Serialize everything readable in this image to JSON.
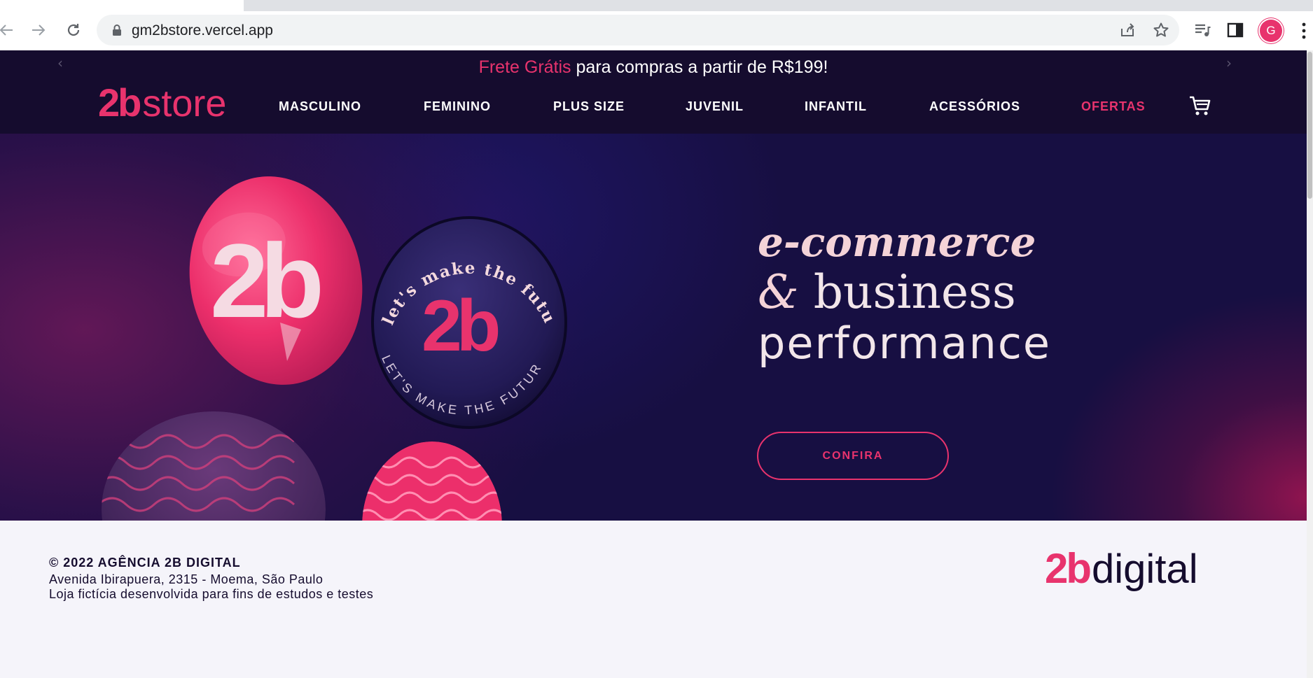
{
  "browser": {
    "url": "gm2bstore.vercel.app",
    "profile_initial": "G",
    "icons": [
      "back-icon",
      "forward-icon",
      "reload-icon",
      "lock-icon",
      "share-icon",
      "star-icon",
      "media-icon",
      "side-panel-icon",
      "menu-icon"
    ]
  },
  "header": {
    "promo_highlight": "Frete Grátis",
    "promo_rest": " para compras a partir de R$199!",
    "prev_arrow": "‹",
    "next_arrow": "›",
    "logo_bold": "2b",
    "logo_light": "store",
    "nav": [
      {
        "label": "MASCULINO"
      },
      {
        "label": "FEMININO"
      },
      {
        "label": "PLUS SIZE"
      },
      {
        "label": "JUVENIL"
      },
      {
        "label": "INFANTIL"
      },
      {
        "label": "ACESSÓRIOS"
      },
      {
        "label": "OFERTAS"
      }
    ]
  },
  "hero": {
    "line1": "e-commerce",
    "line2_amp": "&",
    "line2_rest": " business",
    "line3": "performance",
    "cta_label": "CONFIRA",
    "badge_text": "2b",
    "ring_top": "let's make the future now.",
    "ring_bottom": "LET'S MAKE THE FUTURE NOW."
  },
  "footer": {
    "copyright": "© 2022 AGÊNCIA 2B DIGITAL",
    "address": "Avenida Ibirapuera, 2315 - Moema, São Paulo",
    "disclaimer": "Loja fictícia desenvolvida para fins de estudos e testes",
    "logo_bold": "2b",
    "logo_light": "digital"
  },
  "colors": {
    "brand_pink": "#e8336d",
    "navy": "#150c2e",
    "hero_text": "#f4d3d8"
  }
}
